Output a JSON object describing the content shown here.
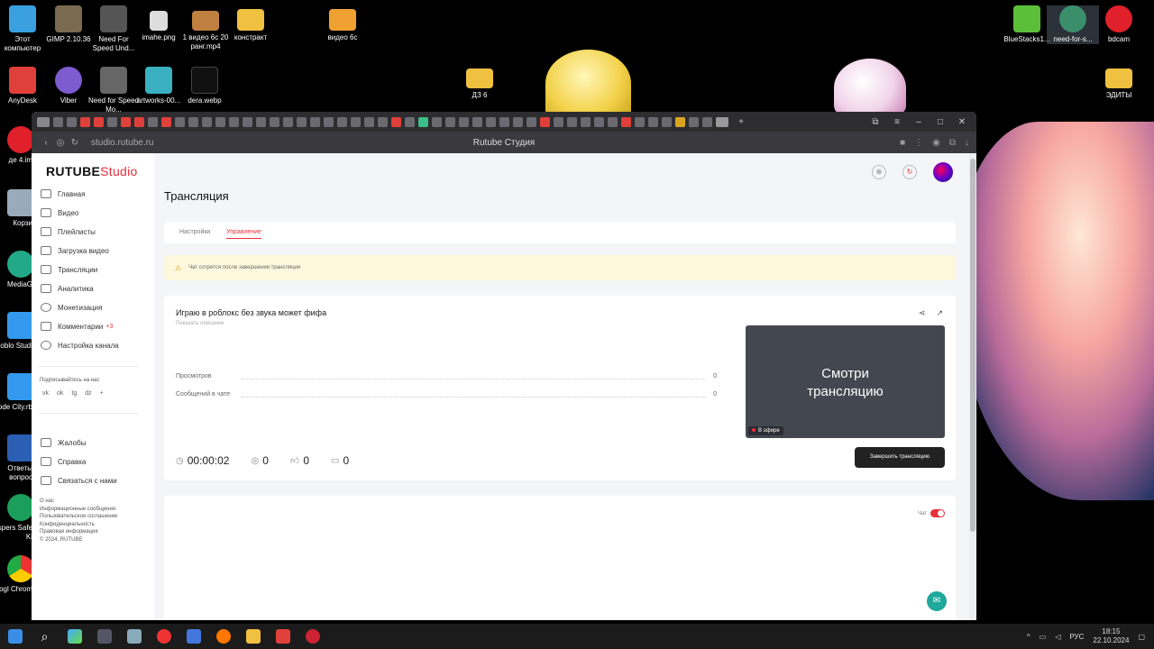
{
  "desktop": {
    "icons": [
      {
        "label": "Этот компьютер",
        "color": "#3aa0e0"
      },
      {
        "label": "GIMP 2.10.36",
        "color": "#7a6a50"
      },
      {
        "label": "Need For Speed Und...",
        "color": "#555"
      },
      {
        "label": "imahe.png",
        "color": "#ddd"
      },
      {
        "label": "1 видео 6с 20 ранг.mp4",
        "color": "#c08040"
      },
      {
        "label": "констракт",
        "color": "#f0c040"
      },
      {
        "label": "видео 6с",
        "color": "#f0a030"
      },
      {
        "label": "AnyDesk",
        "color": "#e0403a"
      },
      {
        "label": "Viber",
        "color": "#7d5ccf"
      },
      {
        "label": "Need for Speed Mo...",
        "color": "#666"
      },
      {
        "label": "artworks-00...",
        "color": "#3ab0c0"
      },
      {
        "label": "dera.webp",
        "color": "#111"
      },
      {
        "label": "ДЗ 6",
        "color": "#f0c040"
      },
      {
        "label": "BlueStacks1...",
        "color": "#5bbf3a"
      },
      {
        "label": "need-for-s...",
        "color": "#3a8f6a"
      },
      {
        "label": "bdcam",
        "color": "#e0202a"
      },
      {
        "label": "ЭДИТЫ",
        "color": "#f0c040"
      }
    ],
    "left_labels": [
      "де 4.im",
      "Корзи",
      "MediaG",
      "Roblo Studi",
      "Mode City.rb",
      "Ответы вопрос",
      "Kaspers Safe Ki",
      "Googl Chrom"
    ]
  },
  "browser": {
    "url": "studio.rutube.ru",
    "page_title": "Rutube Студия"
  },
  "sidebar": {
    "logo_main": "RUTUBE",
    "logo_sub": "Studio",
    "items": [
      {
        "label": "Главная",
        "badge": ""
      },
      {
        "label": "Видео",
        "badge": ""
      },
      {
        "label": "Плейлисты",
        "badge": ""
      },
      {
        "label": "Загрузка видео",
        "badge": ""
      },
      {
        "label": "Трансляции",
        "badge": ""
      },
      {
        "label": "Аналитика",
        "badge": ""
      },
      {
        "label": "Монетизация",
        "badge": ""
      },
      {
        "label": "Комментарии",
        "badge": "+3"
      },
      {
        "label": "Настройка канала",
        "badge": ""
      }
    ],
    "follow_label": "Подписывайтесь на нас",
    "socials": [
      "vk",
      "ok",
      "tg",
      "dz",
      "+"
    ],
    "support": [
      {
        "label": "Жалобы"
      },
      {
        "label": "Справка"
      },
      {
        "label": "Связаться с нами"
      }
    ],
    "footer": [
      "О нас",
      "Информационные сообщения",
      "Пользовательское соглашение",
      "Конфиденциальность",
      "Правовая информация",
      "© 2024, RUTUBE"
    ]
  },
  "main": {
    "title": "Трансляция",
    "tabs": [
      {
        "label": "Настройки",
        "active": false
      },
      {
        "label": "Управление",
        "active": true
      }
    ],
    "notice": "Чат сотрется после завершения трансляции",
    "stream": {
      "title": "Играю в роблокс без звука может фифа",
      "desc_placeholder": "Показать описание",
      "stats": [
        {
          "label": "Просмотров",
          "value": "0"
        },
        {
          "label": "Сообщений в чате",
          "value": "0"
        }
      ],
      "preview_text_1": "Смотри",
      "preview_text_2": "трансляцию",
      "live_label": "В эфире",
      "duration": "00:00:02",
      "viewers": "0",
      "likes": "0",
      "dislikes": "0",
      "end_button": "Завершить трансляцию"
    },
    "chat": {
      "label": "Чат",
      "enabled": true
    }
  },
  "taskbar": {
    "lang": "РУС",
    "time": "18:15",
    "date": "22.10.2024",
    "temp": "7°C"
  }
}
